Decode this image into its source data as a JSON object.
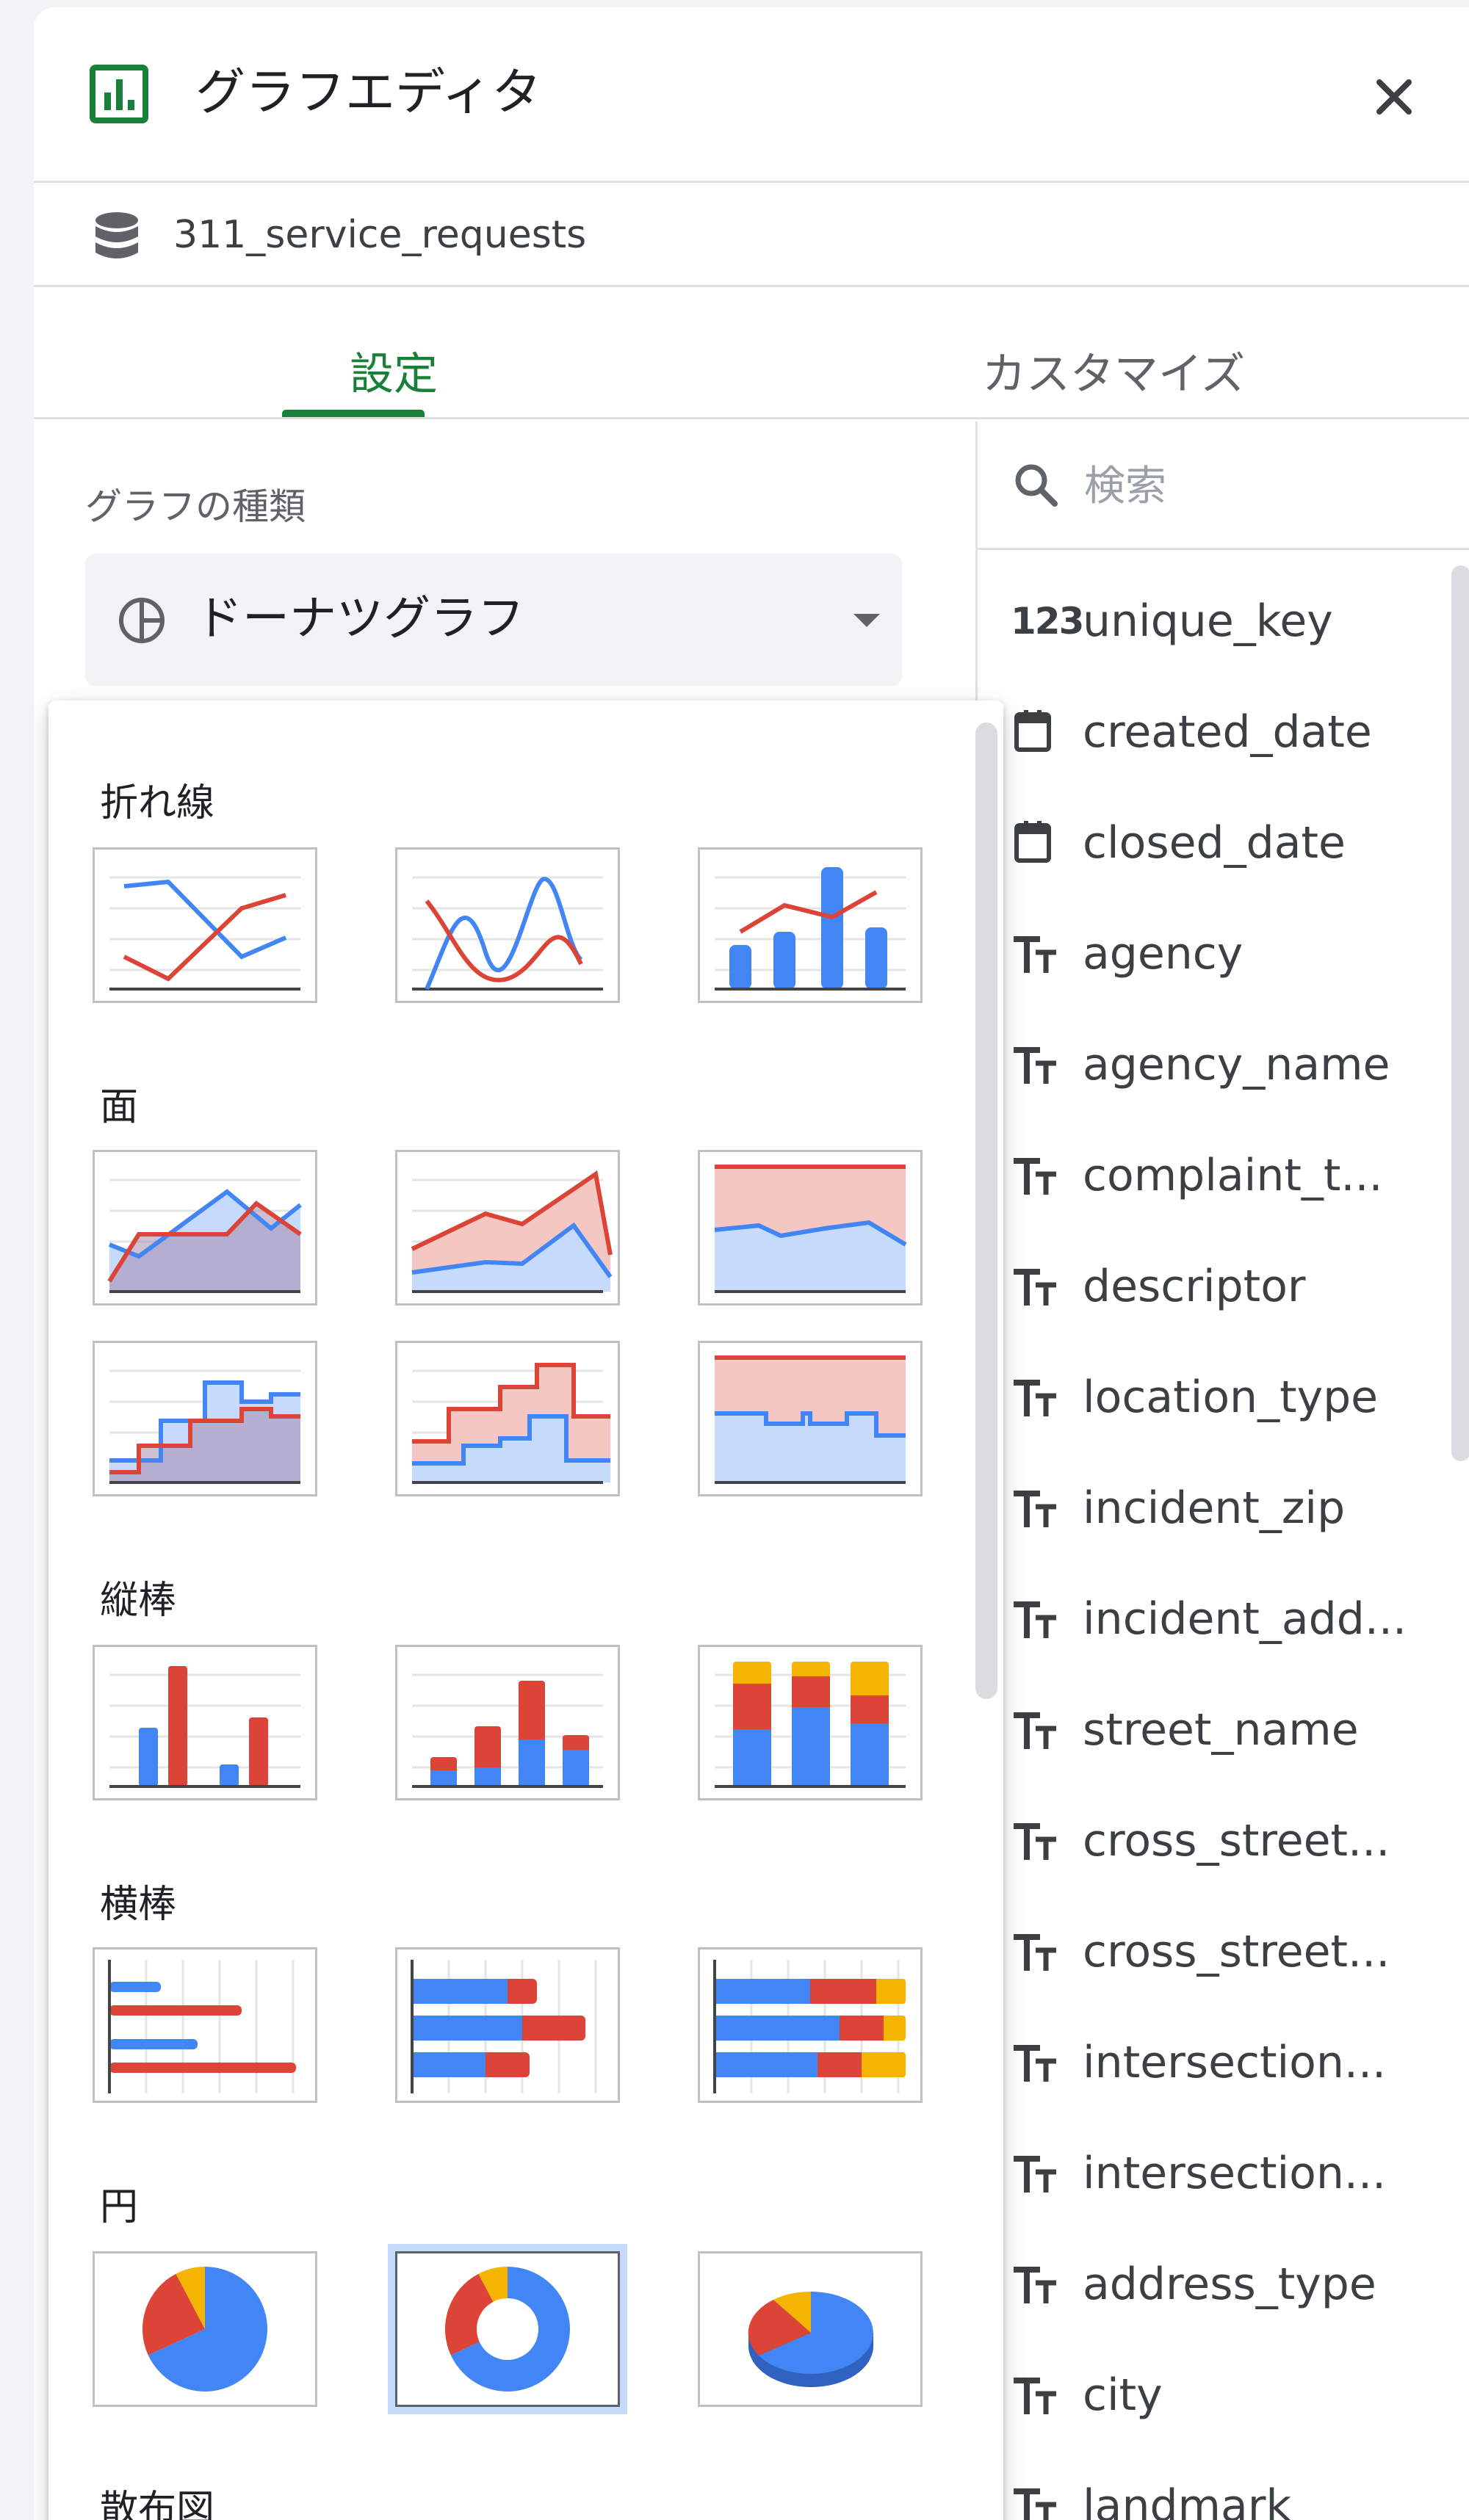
{
  "header": {
    "title": "グラフエディタ",
    "icon": "chart-icon",
    "close": "close-icon"
  },
  "source": {
    "name": "311_service_requests",
    "icon": "database-icon"
  },
  "tabs": [
    {
      "label": "設定",
      "active": true
    },
    {
      "label": "カスタマイズ",
      "active": false
    }
  ],
  "chart_type": {
    "label": "グラフの種類",
    "selected": "ドーナツグラフ",
    "icon": "pie-chart-icon"
  },
  "chart_menu": {
    "categories": [
      {
        "label": "折れ線",
        "thumbnails": [
          "line-chart",
          "smooth-line-chart",
          "combo-chart"
        ]
      },
      {
        "label": "面",
        "thumbnails": [
          "area-chart",
          "stacked-area-chart",
          "100-percent-stacked-area-chart",
          "stepped-area-chart",
          "stacked-stepped-area-chart",
          "100-percent-stacked-stepped-area-chart"
        ]
      },
      {
        "label": "縦棒",
        "thumbnails": [
          "column-chart",
          "stacked-column-chart",
          "100-percent-stacked-column-chart"
        ]
      },
      {
        "label": "横棒",
        "thumbnails": [
          "bar-chart",
          "stacked-bar-chart",
          "100-percent-stacked-bar-chart"
        ]
      },
      {
        "label": "円",
        "thumbnails": [
          "pie-chart",
          "doughnut-chart",
          "3d-pie-chart"
        ]
      },
      {
        "label": "散布図"
      }
    ],
    "selected": "doughnut-chart"
  },
  "fields": {
    "search_placeholder": "検索",
    "items": [
      {
        "name": "unique_key",
        "type": "number",
        "type_label": "123"
      },
      {
        "name": "created_date",
        "type": "date"
      },
      {
        "name": "closed_date",
        "type": "date"
      },
      {
        "name": "agency",
        "type": "text"
      },
      {
        "name": "agency_name",
        "type": "text"
      },
      {
        "name": "complaint_t...",
        "type": "text"
      },
      {
        "name": "descriptor",
        "type": "text"
      },
      {
        "name": "location_type",
        "type": "text"
      },
      {
        "name": "incident_zip",
        "type": "text"
      },
      {
        "name": "incident_add...",
        "type": "text"
      },
      {
        "name": "street_name",
        "type": "text"
      },
      {
        "name": "cross_street...",
        "type": "text"
      },
      {
        "name": "cross_street...",
        "type": "text"
      },
      {
        "name": "intersection...",
        "type": "text"
      },
      {
        "name": "intersection...",
        "type": "text"
      },
      {
        "name": "address_type",
        "type": "text"
      },
      {
        "name": "city",
        "type": "text"
      },
      {
        "name": "landmark",
        "type": "text"
      }
    ]
  },
  "colors": {
    "accent": "#188038",
    "blue": "#4285f4",
    "red": "#db4437",
    "yellow": "#f4b400",
    "selection": "#c6dafc"
  }
}
